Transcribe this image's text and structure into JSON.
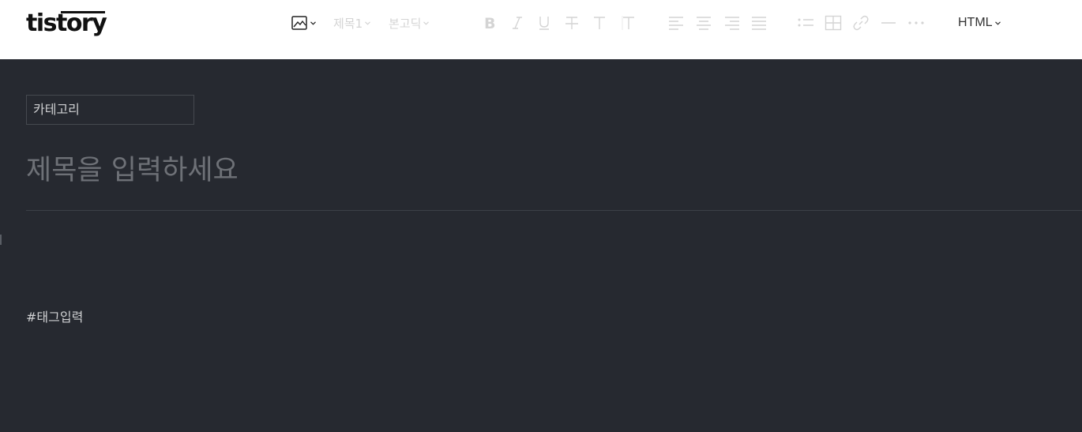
{
  "app": {
    "logo": "tistory"
  },
  "toolbar": {
    "heading_select": "제목1",
    "font_select": "본고딕",
    "mode_select": "HTML",
    "icons": [
      "image-icon",
      "bold-icon",
      "italic-icon",
      "underline-icon",
      "strikethrough-icon",
      "text-color-icon",
      "text-bg-icon",
      "align-left-icon",
      "align-center-icon",
      "align-right-icon",
      "align-justify-icon",
      "list-icon",
      "table-icon",
      "link-icon",
      "horizontal-rule-icon",
      "more-icon"
    ]
  },
  "editor": {
    "category_placeholder": "카테고리",
    "title_placeholder": "제목을 입력하세요",
    "tag_placeholder": "#태그입력"
  },
  "colors": {
    "background": "#262930",
    "header": "#ffffff",
    "disabled_icon": "#d4d4d4"
  }
}
